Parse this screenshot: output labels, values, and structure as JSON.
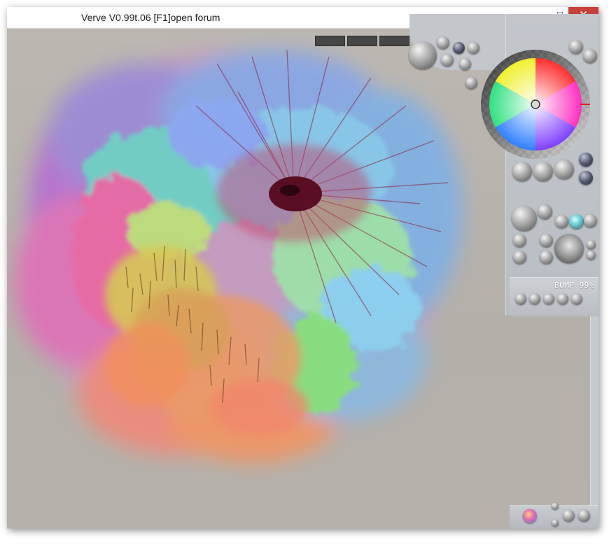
{
  "window": {
    "title": "Verve V0.99t.06 [F1]open forum",
    "minimize_glyph": "–",
    "maximize_glyph": "□",
    "close_glyph": "✕"
  },
  "tool_panel": {
    "bump_label": "BUMP 99%"
  },
  "colors": {
    "canvas_bg": "#b7b2ac",
    "panel_bg": "#c3c7cc",
    "close_button": "#c7403a",
    "selected_hue_marker": "#e0202a"
  },
  "icons": [
    "minimize-icon",
    "maximize-icon",
    "close-icon",
    "color-wheel",
    "brush-preview-icon"
  ]
}
